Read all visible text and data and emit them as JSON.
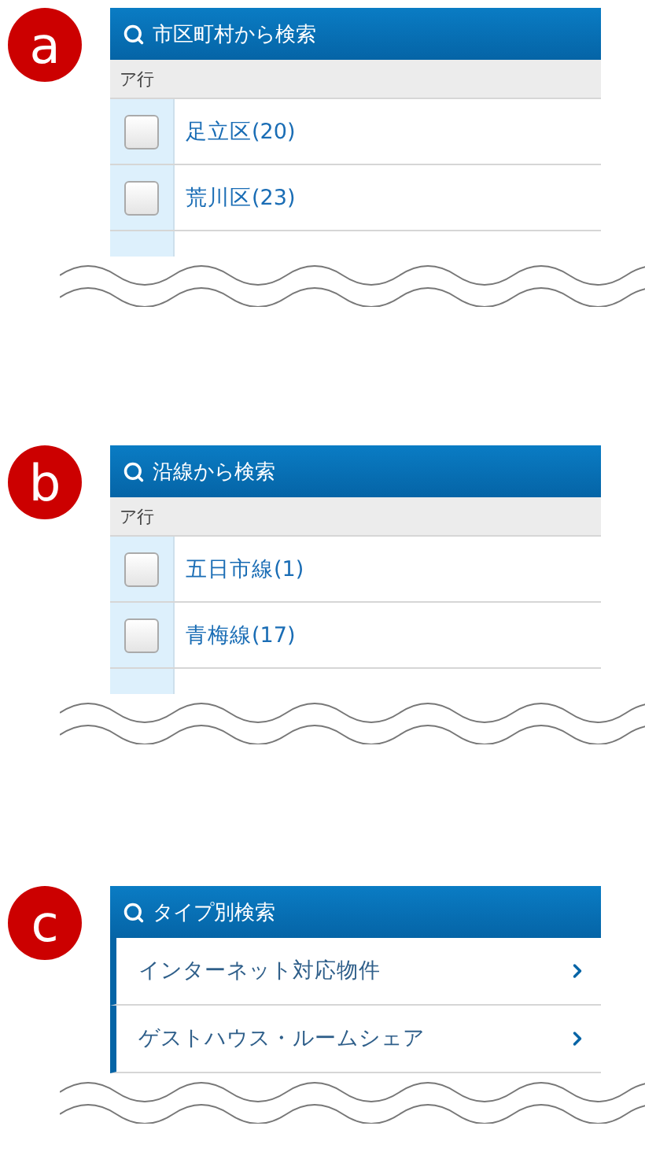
{
  "sections": [
    {
      "badge": "a",
      "title": "市区町村から検索",
      "kind": "checklist",
      "group": "ア行",
      "items": [
        {
          "label": "足立区(20)",
          "checked": false
        },
        {
          "label": "荒川区(23)",
          "checked": false
        }
      ]
    },
    {
      "badge": "b",
      "title": "沿線から検索",
      "kind": "checklist",
      "group": "ア行",
      "items": [
        {
          "label": "五日市線(1)",
          "checked": false
        },
        {
          "label": "青梅線(17)",
          "checked": false
        }
      ]
    },
    {
      "badge": "c",
      "title": "タイプ別検索",
      "kind": "links",
      "items": [
        {
          "label": "インターネット対応物件"
        },
        {
          "label": "ゲストハウス・ルームシェア"
        }
      ]
    }
  ]
}
